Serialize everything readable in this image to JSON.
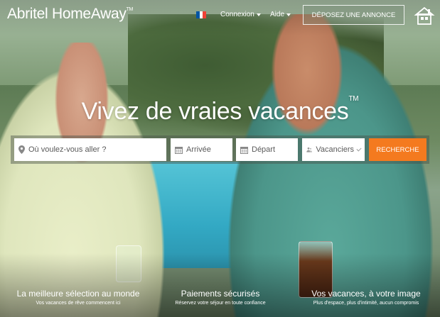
{
  "header": {
    "logo": "Abritel HomeAway",
    "logo_tm": "TM",
    "nav": [
      {
        "label": "Connexion"
      },
      {
        "label": "Aide"
      }
    ],
    "post_button": "DÉPOSEZ UNE ANNONCE",
    "flag_colors": [
      "#0055a4",
      "#ffffff",
      "#ef4135"
    ]
  },
  "hero": {
    "headline": "Vivez de vraies vacances",
    "headline_tm": "TM"
  },
  "search": {
    "destination_placeholder": "Où voulez-vous aller ?",
    "arrival_placeholder": "Arrivée",
    "departure_placeholder": "Départ",
    "travelers_placeholder": "Vacanciers",
    "button": "RECHERCHE",
    "button_color": "#f47a1f"
  },
  "features": [
    {
      "title": "La meilleure sélection au monde",
      "subtitle": "Vos vacances de rêve commencent ici"
    },
    {
      "title": "Paiements sécurisés",
      "subtitle": "Réservez votre séjour en toute confiance"
    },
    {
      "title": "Vos vacances, à votre image",
      "subtitle": "Plus d'espace, plus d'intimité, aucun compromis"
    }
  ]
}
